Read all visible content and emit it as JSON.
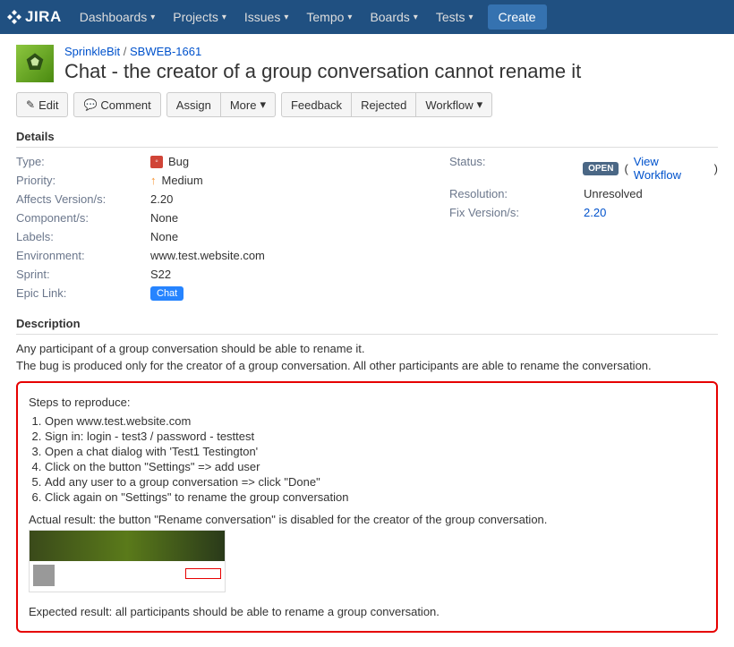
{
  "nav": {
    "brand": "JIRA",
    "items": [
      "Dashboards",
      "Projects",
      "Issues",
      "Tempo",
      "Boards",
      "Tests"
    ],
    "create": "Create"
  },
  "breadcrumb": {
    "project": "SprinkleBit",
    "key": "SBWEB-1661"
  },
  "title": "Chat - the creator of a group conversation cannot rename it",
  "toolbar": {
    "edit": "Edit",
    "comment": "Comment",
    "assign": "Assign",
    "more": "More",
    "feedback": "Feedback",
    "rejected": "Rejected",
    "workflow": "Workflow"
  },
  "sections": {
    "details": "Details",
    "description": "Description"
  },
  "details": {
    "left": {
      "type_label": "Type:",
      "type_value": "Bug",
      "priority_label": "Priority:",
      "priority_value": "Medium",
      "affects_label": "Affects Version/s:",
      "affects_value": "2.20",
      "components_label": "Component/s:",
      "components_value": "None",
      "labels_label": "Labels:",
      "labels_value": "None",
      "env_label": "Environment:",
      "env_value": "www.test.website.com",
      "sprint_label": "Sprint:",
      "sprint_value": "S22",
      "epic_label": "Epic Link:",
      "epic_value": "Chat"
    },
    "right": {
      "status_label": "Status:",
      "status_badge": "OPEN",
      "status_link": "View Workflow",
      "resolution_label": "Resolution:",
      "resolution_value": "Unresolved",
      "fix_label": "Fix Version/s:",
      "fix_value": "2.20"
    }
  },
  "description": {
    "line1": "Any participant of a group conversation should be able to rename it.",
    "line2": "The bug is produced only for the creator of a group conversation. All other participants are able to rename the conversation.",
    "steps_title": "Steps to reproduce:",
    "steps": [
      "Open www.test.website.com",
      "Sign in: login - test3 / password - testtest",
      "Open a chat dialog with 'Test1 Testington'",
      "Click on the button \"Settings\" => add user",
      "Add any user to a group conversation => click \"Done\"",
      "Click again on \"Settings\" to rename the group conversation"
    ],
    "actual": "Actual result: the button \"Rename conversation\" is disabled for the creator of the group conversation.",
    "expected": "Expected result: all participants should be able to rename a group conversation."
  }
}
